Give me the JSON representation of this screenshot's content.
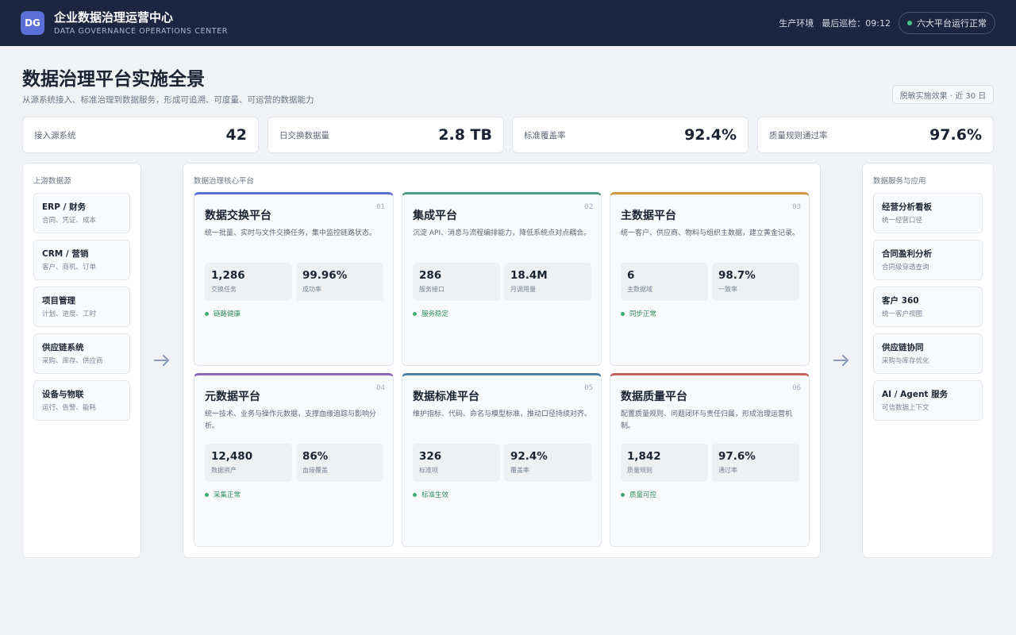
{
  "header": {
    "logo": "DG",
    "title": "企业数据治理运营中心",
    "subtitle": "DATA GOVERNANCE OPERATIONS CENTER",
    "env": "生产环境",
    "last_check": "最后巡检：09:12",
    "status": "六大平台运行正常"
  },
  "page": {
    "title": "数据治理平台实施全景",
    "subtitle": "从源系统接入、标准治理到数据服务，形成可追溯、可度量、可运营的数据能力",
    "period": "脱敏实施效果 · 近 30 日"
  },
  "kpis": [
    {
      "label": "接入源系统",
      "value": "42"
    },
    {
      "label": "日交换数据量",
      "value": "2.8 TB"
    },
    {
      "label": "标准覆盖率",
      "value": "92.4%"
    },
    {
      "label": "质量规则通过率",
      "value": "97.6%"
    }
  ],
  "sources": {
    "title": "上游数据源",
    "items": [
      {
        "name": "ERP / 财务",
        "desc": "合同、凭证、成本"
      },
      {
        "name": "CRM / 营销",
        "desc": "客户、商机、订单"
      },
      {
        "name": "项目管理",
        "desc": "计划、进度、工时"
      },
      {
        "name": "供应链系统",
        "desc": "采购、库存、供应商"
      },
      {
        "name": "设备与物联",
        "desc": "运行、告警、能耗"
      }
    ]
  },
  "core": {
    "title": "数据治理核心平台",
    "cards": [
      {
        "num": "01",
        "name": "数据交换平台",
        "desc": "统一批量、实时与文件交换任务，集中监控链路状态。",
        "m1v": "1,286",
        "m1l": "交换任务",
        "m2v": "99.96%",
        "m2l": "成功率",
        "status": "链路健康",
        "accent": "#5a6fd8"
      },
      {
        "num": "02",
        "name": "集成平台",
        "desc": "沉淀 API、消息与流程编排能力，降低系统点对点耦合。",
        "m1v": "286",
        "m1l": "服务接口",
        "m2v": "18.4M",
        "m2l": "月调用量",
        "status": "服务稳定",
        "accent": "#4f9d86"
      },
      {
        "num": "03",
        "name": "主数据平台",
        "desc": "统一客户、供应商、物料与组织主数据，建立黄金记录。",
        "m1v": "6",
        "m1l": "主数据域",
        "m2v": "98.7%",
        "m2l": "一致率",
        "status": "同步正常",
        "accent": "#d09a45"
      },
      {
        "num": "04",
        "name": "元数据平台",
        "desc": "统一技术、业务与操作元数据，支撑血缘追踪与影响分析。",
        "m1v": "12,480",
        "m1l": "数据资产",
        "m2v": "86%",
        "m2l": "血缘覆盖",
        "status": "采集正常",
        "accent": "#8a68b8"
      },
      {
        "num": "05",
        "name": "数据标准平台",
        "desc": "维护指标、代码、命名与模型标准，推动口径持续对齐。",
        "m1v": "326",
        "m1l": "标准项",
        "m2v": "92.4%",
        "m2l": "覆盖率",
        "status": "标准生效",
        "accent": "#4b7fa6"
      },
      {
        "num": "06",
        "name": "数据质量平台",
        "desc": "配置质量规则、问题闭环与责任归属，形成治理运营机制。",
        "m1v": "1,842",
        "m1l": "质量规则",
        "m2v": "97.6%",
        "m2l": "通过率",
        "status": "质量可控",
        "accent": "#c5605f"
      }
    ]
  },
  "services": {
    "title": "数据服务与应用",
    "items": [
      {
        "name": "经营分析看板",
        "desc": "统一经营口径"
      },
      {
        "name": "合同盈利分析",
        "desc": "合同级穿透查询"
      },
      {
        "name": "客户 360",
        "desc": "统一客户视图"
      },
      {
        "name": "供应链协同",
        "desc": "采购与库存优化"
      },
      {
        "name": "AI / Agent 服务",
        "desc": "可信数据上下文"
      }
    ]
  },
  "colors": {
    "topbar": "#1c2640",
    "brand": "#5a6fd8",
    "ok": "#3fae76"
  },
  "icons": {
    "arrow": "arrow-right-icon",
    "status": "status-dot-icon"
  }
}
